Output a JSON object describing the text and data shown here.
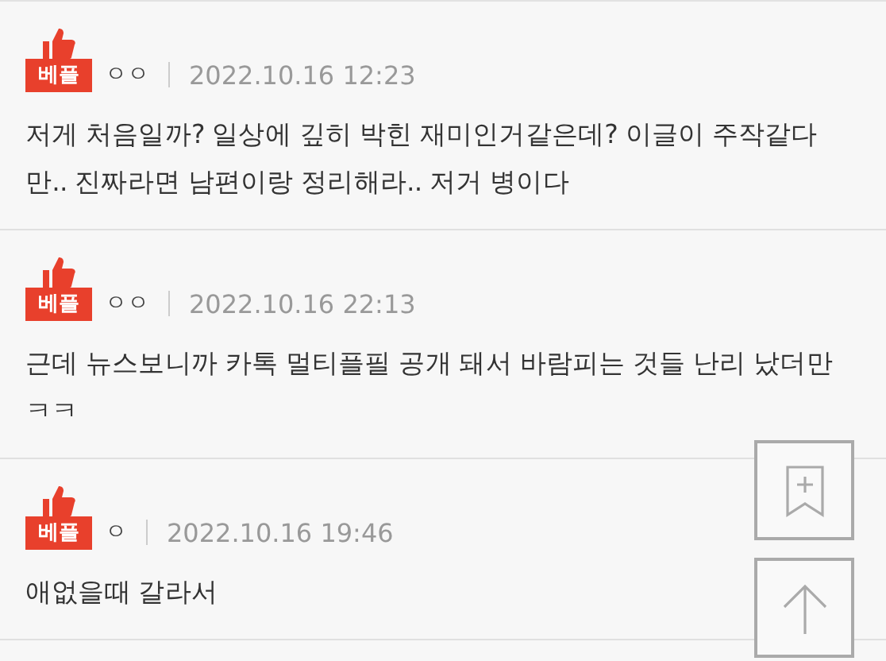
{
  "comments": [
    {
      "badge": "베플",
      "author": "ㅇㅇ",
      "time": "2022.10.16 12:23",
      "text": "저게 처음일까? 일상에 깊히 박힌 재미인거같은데? 이글이 주작같다만.. 진짜라면 남편이랑 정리해라.. 저거 병이다"
    },
    {
      "badge": "베플",
      "author": "ㅇㅇ",
      "time": "2022.10.16 22:13",
      "text": "근데 뉴스보니까 카톡 멀티플필 공개 돼서 바람피는 것들 난리 났더만 ㅋㅋ"
    },
    {
      "badge": "베플",
      "author": "ㅇ",
      "time": "2022.10.16 19:46",
      "text": "애없을때 갈라서"
    }
  ]
}
